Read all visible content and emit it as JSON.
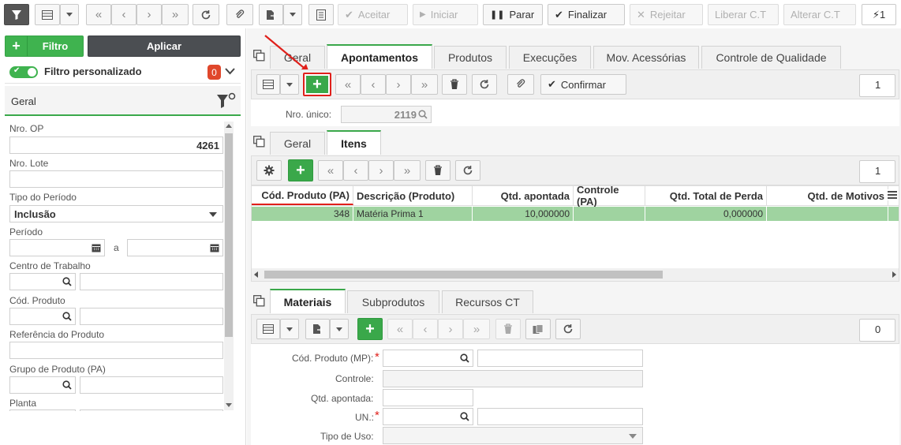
{
  "top_toolbar": {
    "aceitar": "Aceitar",
    "iniciar": "Iniciar",
    "parar": "Parar",
    "finalizar": "Finalizar",
    "rejeitar": "Rejeitar",
    "liberar": "Liberar C.T",
    "alterar": "Alterar C.T",
    "counter": "1"
  },
  "left_panel": {
    "filtro_button": "Filtro",
    "aplicar_button": "Aplicar",
    "filtro_personalizado": "Filtro personalizado",
    "filtro_count": "0",
    "section_title": "Geral",
    "fields": {
      "nro_op_label": "Nro. OP",
      "nro_op_value": "4261",
      "nro_lote_label": "Nro. Lote",
      "tipo_periodo_label": "Tipo do Período",
      "tipo_periodo_value": "Inclusão",
      "periodo_label": "Período",
      "periodo_sep": "a",
      "centro_label": "Centro de Trabalho",
      "cod_produto_label": "Cód. Produto",
      "referencia_label": "Referência do Produto",
      "grupo_label": "Grupo de Produto (PA)",
      "planta_label": "Planta"
    }
  },
  "main_tabs": [
    "Geral",
    "Apontamentos",
    "Produtos",
    "Execuções",
    "Mov. Acessórias",
    "Controle de Qualidade"
  ],
  "apontamentos": {
    "confirmar_label": "Confirmar",
    "counter": "1",
    "nro_unico_label": "Nro. único:",
    "nro_unico_value": "2119"
  },
  "sub_tabs": [
    "Geral",
    "Itens"
  ],
  "itens": {
    "counter": "1",
    "columns": [
      "Cód. Produto (PA)",
      "Descrição (Produto)",
      "Qtd. apontada",
      "Controle (PA)",
      "Qtd. Total de Perda",
      "Qtd. de Motivos"
    ],
    "rows": [
      [
        "348",
        "Matéria Prima 1",
        "10,000000",
        "",
        "0,000000",
        ""
      ]
    ]
  },
  "bottom_tabs": [
    "Materiais",
    "Subprodutos",
    "Recursos CT"
  ],
  "materiais": {
    "counter": "0",
    "cod_produto_label": "Cód. Produto (MP):",
    "controle_label": "Controle:",
    "qtd_label": "Qtd. apontada:",
    "un_label": "UN.:",
    "tipo_uso_label": "Tipo de Uso:"
  },
  "colors": {
    "accent_green": "#3aa84a",
    "highlight_red": "#e0201b",
    "row_green": "#9fd3a0"
  }
}
